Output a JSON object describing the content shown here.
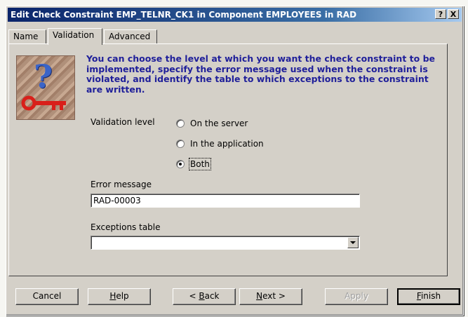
{
  "window": {
    "title": "Edit Check Constraint EMP_TELNR_CK1 in Component EMPLOYEES in RAD",
    "help_btn": "?",
    "close_btn": "X"
  },
  "tabs": [
    {
      "label": "Name",
      "active": false
    },
    {
      "label": "Validation",
      "active": true
    },
    {
      "label": "Advanced",
      "active": false
    }
  ],
  "intro_text": "You can choose the level at which you want the check constraint to be implemented, specify the error message used when the constraint is violated, and identify the table to which exceptions to the constraint are written.",
  "validation": {
    "label": "Validation level",
    "options": [
      {
        "label": "On the server",
        "checked": false
      },
      {
        "label": "In the application",
        "checked": false
      },
      {
        "label": "Both",
        "checked": true
      }
    ]
  },
  "error_message": {
    "label": "Error message",
    "value": "RAD-00003"
  },
  "exceptions_table": {
    "label": "Exceptions table",
    "value": ""
  },
  "buttons": {
    "cancel": "Cancel",
    "help_prefix": "",
    "help_u": "H",
    "help_rest": "elp",
    "back_prefix": "< ",
    "back_u": "B",
    "back_rest": "ack",
    "next_u": "N",
    "next_rest": "ext >",
    "apply": "Apply",
    "finish_u": "F",
    "finish_rest": "inish"
  },
  "colors": {
    "title_bar_start": "#0a246a",
    "intro_text": "#1f1f9a",
    "dialog_face": "#d4d0c8"
  }
}
